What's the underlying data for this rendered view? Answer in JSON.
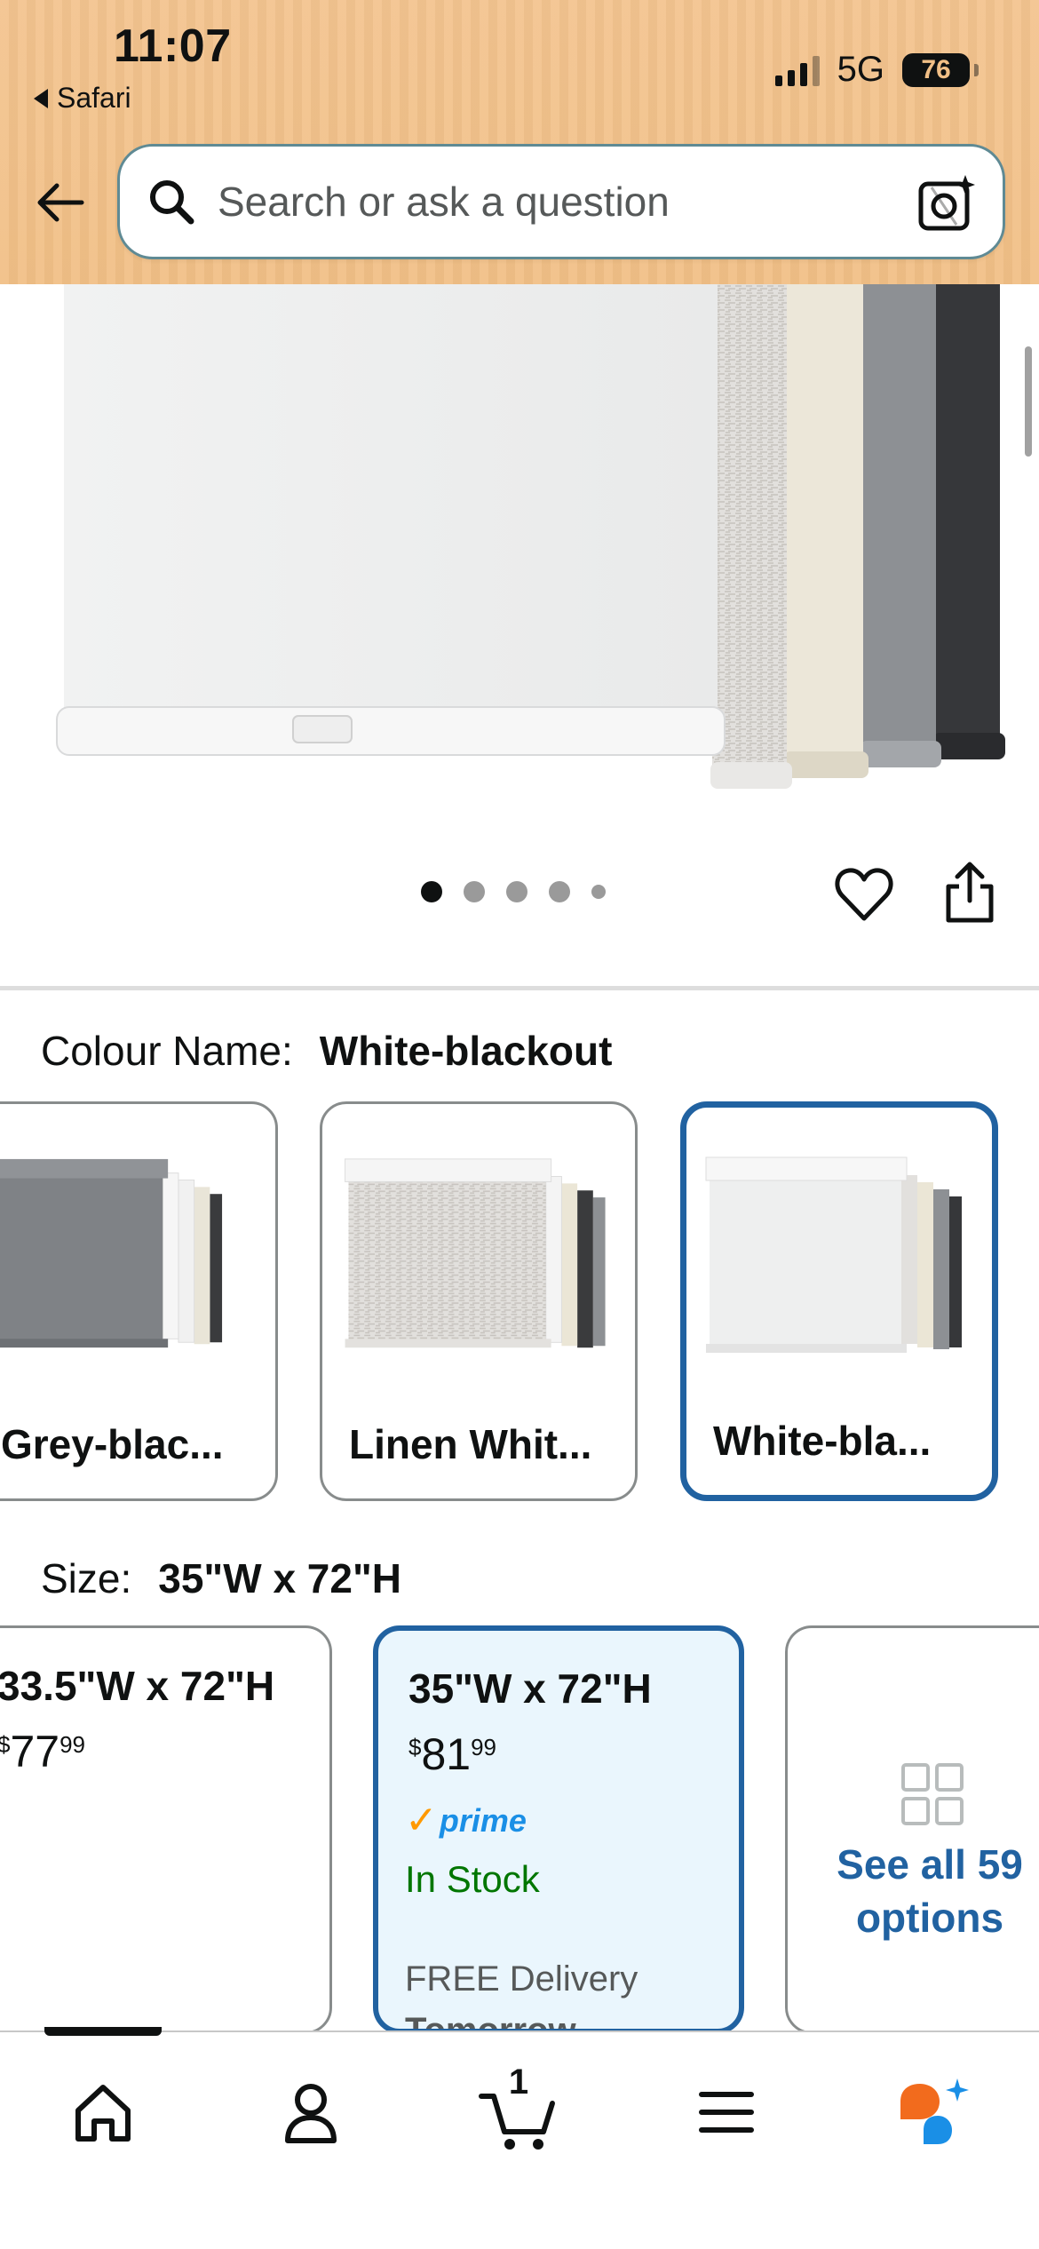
{
  "status_bar": {
    "time": "11:07",
    "back_app": "Safari",
    "network": "5G",
    "battery": "76"
  },
  "search": {
    "placeholder": "Search or ask a question"
  },
  "image_carousel": {
    "page_count": 5,
    "active_index": 0
  },
  "colour": {
    "label": "Colour Name:",
    "selected": "White-blackout",
    "options": [
      {
        "name": "Grey-blac..."
      },
      {
        "name": "Linen Whit..."
      },
      {
        "name": "White-bla..."
      }
    ]
  },
  "size": {
    "label": "Size:",
    "selected": "35\"W x 72\"H",
    "options": [
      {
        "title": "33.5\"W x 72\"H",
        "price_symbol": "$",
        "price_whole": "77",
        "price_fraction": "99"
      },
      {
        "title": "35\"W x 72\"H",
        "price_symbol": "$",
        "price_whole": "81",
        "price_fraction": "99",
        "prime": "prime",
        "stock": "In Stock",
        "delivery": "FREE Delivery",
        "delivery_day": "Tomorrow"
      }
    ],
    "see_all": "See all 59 options"
  },
  "bottom_nav": {
    "items": [
      "home-icon",
      "account-icon",
      "cart-icon",
      "menu-icon",
      "rufus-assistant-icon"
    ],
    "cart_count": "1"
  },
  "colors": {
    "header_bg": "#f1bf86",
    "selected_border": "#2162a1",
    "in_stock": "#007600",
    "prime_blue": "#1a8fe6",
    "prime_check": "#ff9900"
  }
}
